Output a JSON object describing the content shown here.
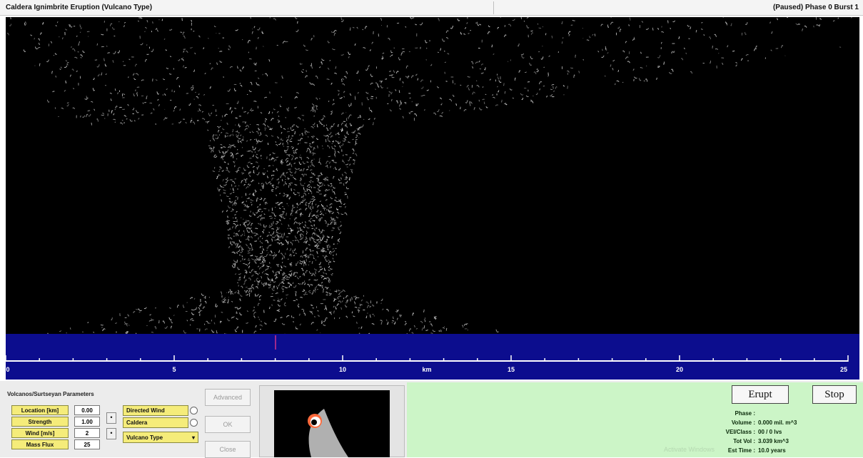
{
  "window": {
    "title": "Caldera Ignimbrite Eruption (Vulcano Type)",
    "status_right": "(Paused) Phase 0 Burst 1"
  },
  "sim_view": {
    "background": "#000000",
    "particle_color": "#d8d8d8"
  },
  "ground": {
    "color": "#0c0d8e",
    "scale_color": "#ffffff",
    "ticks": [
      "0",
      "5",
      "10",
      "km",
      "15",
      "20",
      "25"
    ]
  },
  "parameters": {
    "group_title": "Volcanos/Surtseyan Parameters",
    "rows": [
      {
        "label": "Location [km]",
        "value": "0.00"
      },
      {
        "label": "Strength",
        "value": "1.00"
      },
      {
        "label": "Wind [m/s]",
        "value": "2"
      },
      {
        "label": "Mass Flux",
        "value": "25"
      }
    ]
  },
  "options": {
    "items": [
      "Directed Wind",
      "Caldera"
    ],
    "dropdown_selected": "Vulcano Type"
  },
  "side_buttons": {
    "advanced": "Advanced",
    "ok": "OK",
    "close": "Close"
  },
  "preview": {
    "background": "#000000",
    "shape_color": "#b0b0b0",
    "eye_color": "#ff6a3c"
  },
  "actions": {
    "erupt": "Erupt",
    "stop": "Stop"
  },
  "stats": {
    "phase": {
      "label": "Phase :",
      "value": ""
    },
    "volume": {
      "label": "Volume :",
      "value": "0.000 mil. m^3"
    },
    "vei": {
      "label": "VEI/Class :",
      "value": "00 / 0 lvs"
    },
    "tot_vol": {
      "label": "Tot Vol :",
      "value": "3.039 km^3"
    },
    "est_time": {
      "label": "Est Time :",
      "value": "10.0 years"
    }
  },
  "watermark": "Activate Windows"
}
